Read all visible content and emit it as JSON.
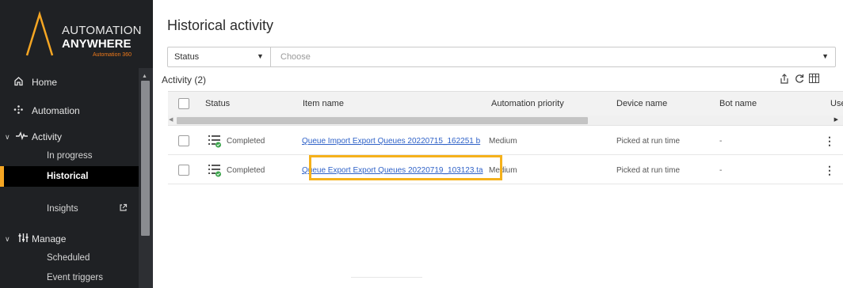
{
  "brand": {
    "line1": "AUTOMATION",
    "line2": "ANYWHERE",
    "line3": "Automation 360",
    "accent_color": "#f5a623",
    "tagline_color": "#f07a1a"
  },
  "sidebar": {
    "home": {
      "label": "Home",
      "icon": "home-icon"
    },
    "automation": {
      "label": "Automation",
      "icon": "automation-icon"
    },
    "activity": {
      "label": "Activity",
      "icon": "activity-pulse-icon",
      "children": [
        "In progress",
        "Historical"
      ]
    },
    "insights": {
      "label": "Insights",
      "icon": "external-link-icon"
    },
    "manage": {
      "label": "Manage",
      "icon": "manage-sliders-icon",
      "children": [
        "Scheduled",
        "Event triggers"
      ]
    },
    "active_item": "Historical"
  },
  "main": {
    "title": "Historical activity",
    "filter": {
      "field_value": "Status",
      "placeholder": "Choose"
    },
    "activity_count": "Activity (2)",
    "table": {
      "columns": [
        "Status",
        "Item name",
        "Automation priority",
        "Device name",
        "Bot name",
        "User"
      ],
      "rows": [
        {
          "status": "Completed",
          "item_name": "Queue Import Export Queues 20220715_162251 b",
          "priority": "Medium",
          "device": "Picked at run time",
          "bot": "-"
        },
        {
          "status": "Completed",
          "item_name": "Queue Export Export Queues 20220719_103123.ta",
          "priority": "Medium",
          "device": "Picked at run time",
          "bot": "-"
        }
      ]
    }
  }
}
